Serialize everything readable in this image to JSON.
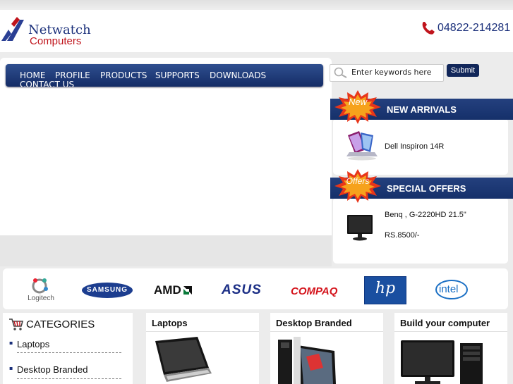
{
  "header": {
    "logo_line1": "Netwatch",
    "logo_line2": "Computers",
    "phone": "04822-214281"
  },
  "nav": {
    "items": [
      "HOME",
      "PROFILE",
      "PRODUCTS",
      "SUPPORTS",
      "DOWNLOADS",
      "CONTACT US"
    ]
  },
  "search": {
    "placeholder": "Enter keywords here",
    "submit_label": "Submit"
  },
  "new_arrivals": {
    "badge": "New",
    "title": "NEW ARRIVALS",
    "product": "Dell Inspiron 14R"
  },
  "special_offers": {
    "badge": "Offers",
    "title": "SPECIAL OFFERS",
    "product": "Benq , G-2220HD 21.5\"",
    "price": "RS.8500/-"
  },
  "brands": [
    "Logitech",
    "SAMSUNG",
    "AMD",
    "ASUS",
    "COMPAQ",
    "hp",
    "intel"
  ],
  "categories": {
    "title": "CATEGORIES",
    "items": [
      "Laptops",
      "Desktop Branded"
    ]
  },
  "product_boxes": [
    "Laptops",
    "Desktop Branded",
    "Build your computer"
  ],
  "colors": {
    "brand_blue": "#1a2f7a",
    "brand_red": "#c0141c",
    "nav_blue": "#142c66",
    "badge_red": "#e8361a"
  }
}
